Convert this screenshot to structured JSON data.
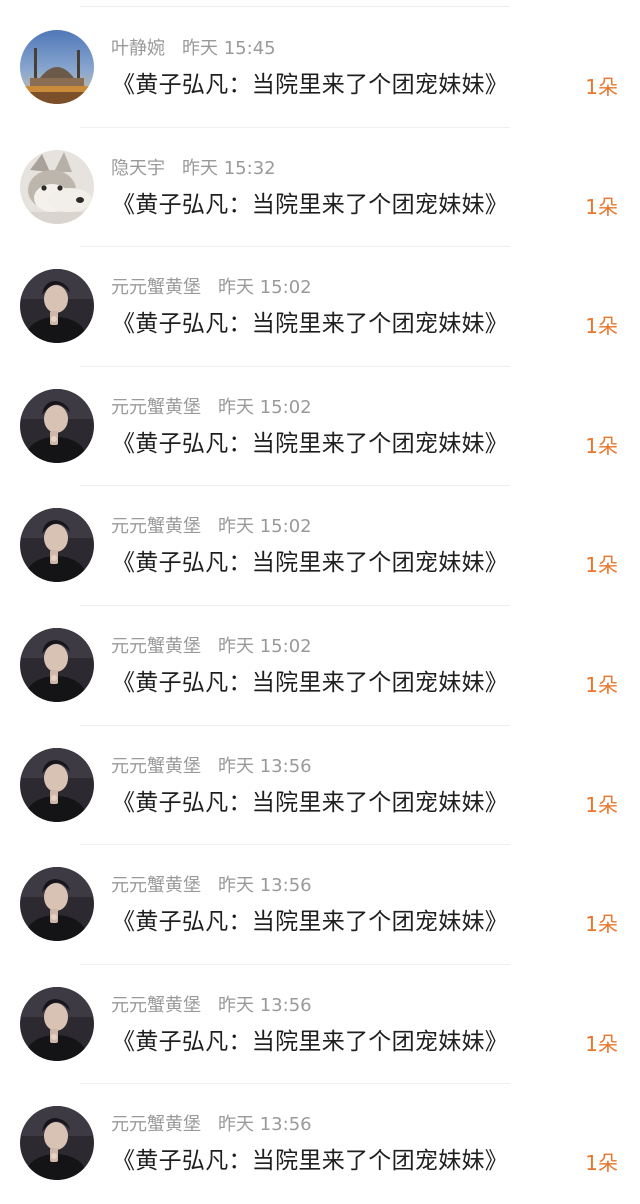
{
  "items": [
    {
      "name": "叶静婉",
      "time": "昨天 15:45",
      "title": "《黄子弘凡：当院里来了个团宠妹妹》",
      "count": "1朵",
      "avatar": "cityscape-avatar-icon"
    },
    {
      "name": "隐天宇",
      "time": "昨天 15:32",
      "title": "《黄子弘凡：当院里来了个团宠妹妹》",
      "count": "1朵",
      "avatar": "husky-dog-avatar-icon"
    },
    {
      "name": "元元蟹黄堡",
      "time": "昨天 15:02",
      "title": "《黄子弘凡：当院里来了个团宠妹妹》",
      "count": "1朵",
      "avatar": "portrait-avatar-icon"
    },
    {
      "name": "元元蟹黄堡",
      "time": "昨天 15:02",
      "title": "《黄子弘凡：当院里来了个团宠妹妹》",
      "count": "1朵",
      "avatar": "portrait-avatar-icon"
    },
    {
      "name": "元元蟹黄堡",
      "time": "昨天 15:02",
      "title": "《黄子弘凡：当院里来了个团宠妹妹》",
      "count": "1朵",
      "avatar": "portrait-avatar-icon"
    },
    {
      "name": "元元蟹黄堡",
      "time": "昨天 15:02",
      "title": "《黄子弘凡：当院里来了个团宠妹妹》",
      "count": "1朵",
      "avatar": "portrait-avatar-icon"
    },
    {
      "name": "元元蟹黄堡",
      "time": "昨天 13:56",
      "title": "《黄子弘凡：当院里来了个团宠妹妹》",
      "count": "1朵",
      "avatar": "portrait-avatar-icon"
    },
    {
      "name": "元元蟹黄堡",
      "time": "昨天 13:56",
      "title": "《黄子弘凡：当院里来了个团宠妹妹》",
      "count": "1朵",
      "avatar": "portrait-avatar-icon"
    },
    {
      "name": "元元蟹黄堡",
      "time": "昨天 13:56",
      "title": "《黄子弘凡：当院里来了个团宠妹妹》",
      "count": "1朵",
      "avatar": "portrait-avatar-icon"
    },
    {
      "name": "元元蟹黄堡",
      "time": "昨天 13:56",
      "title": "《黄子弘凡：当院里来了个团宠妹妹》",
      "count": "1朵",
      "avatar": "portrait-avatar-icon"
    }
  ],
  "colors": {
    "count_accent": "#e8762d",
    "meta_text": "#9a9a9a",
    "title_text": "#1f1f1f"
  }
}
